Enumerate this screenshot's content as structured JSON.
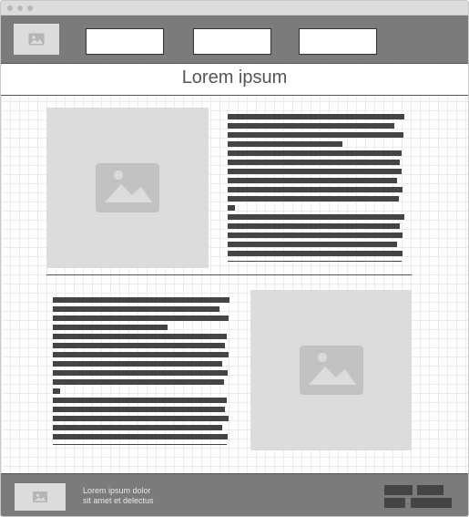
{
  "hero": {
    "title": "Lorem ipsum"
  },
  "footer": {
    "text_line1": "Lorem ipsum dolor",
    "text_line2": "sit amet et delectus"
  },
  "icons": {
    "header_logo": "image-placeholder-icon",
    "content_images": "image-placeholder-icon",
    "footer_logo": "image-placeholder-icon"
  },
  "colors": {
    "header_footer_bg": "#7b7b7b",
    "placeholder_bg": "#dcdcdc",
    "placeholder_icon": "#c2c2c2",
    "text_line": "#444444"
  }
}
